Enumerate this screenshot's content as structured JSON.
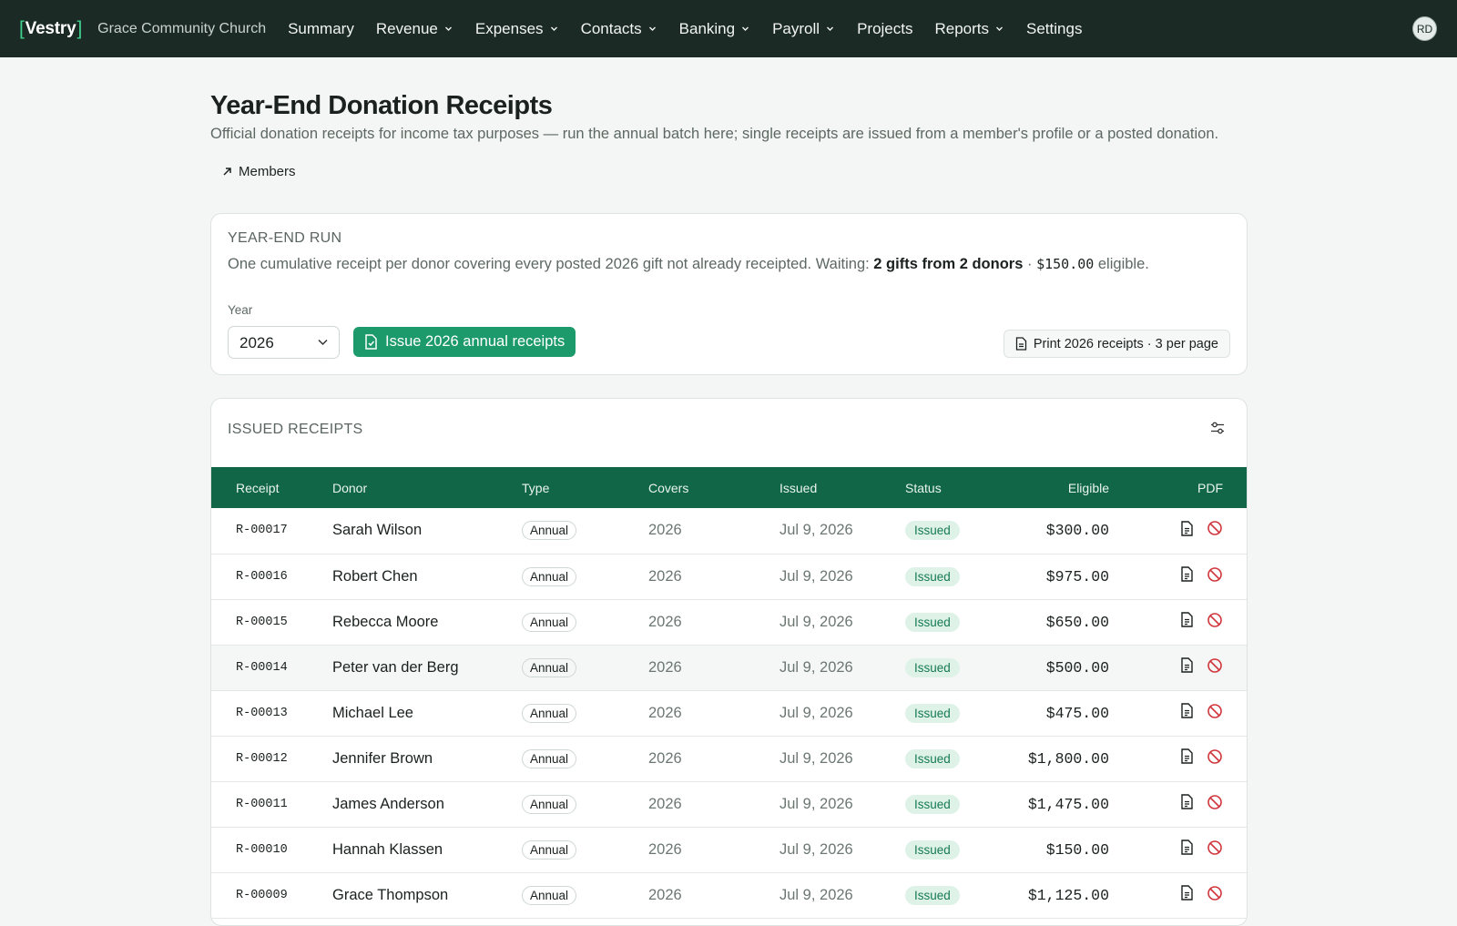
{
  "nav": {
    "logo": "Vestry",
    "org": "Grace Community Church",
    "items": [
      {
        "label": "Summary",
        "dropdown": false
      },
      {
        "label": "Revenue",
        "dropdown": true
      },
      {
        "label": "Expenses",
        "dropdown": true
      },
      {
        "label": "Contacts",
        "dropdown": true
      },
      {
        "label": "Banking",
        "dropdown": true
      },
      {
        "label": "Payroll",
        "dropdown": true
      },
      {
        "label": "Projects",
        "dropdown": false
      },
      {
        "label": "Reports",
        "dropdown": true
      },
      {
        "label": "Settings",
        "dropdown": false
      }
    ],
    "avatar": "RD"
  },
  "page": {
    "title": "Year-End Donation Receipts",
    "subtitle": "Official donation receipts for income tax purposes — run the annual batch here; single receipts are issued from a member's profile or a posted donation.",
    "members_link": "Members"
  },
  "run": {
    "label": "YEAR-END RUN",
    "desc_prefix": "One cumulative receipt per donor covering every posted 2026 gift not already receipted. Waiting: ",
    "desc_waiting": "2 gifts from 2 donors",
    "desc_sep": " · ",
    "desc_amount": "$150.00",
    "desc_suffix": " eligible.",
    "year_label": "Year",
    "year_value": "2026",
    "issue_button": "Issue 2026 annual receipts",
    "print_button": "Print 2026 receipts · 3 per page"
  },
  "receipts": {
    "label": "ISSUED RECEIPTS",
    "columns": {
      "receipt": "Receipt",
      "donor": "Donor",
      "type": "Type",
      "covers": "Covers",
      "issued": "Issued",
      "status": "Status",
      "eligible": "Eligible",
      "pdf": "PDF"
    },
    "rows": [
      {
        "receipt": "R-00017",
        "donor": "Sarah Wilson",
        "type": "Annual",
        "covers": "2026",
        "issued": "Jul 9, 2026",
        "status": "Issued",
        "eligible": "$300.00"
      },
      {
        "receipt": "R-00016",
        "donor": "Robert Chen",
        "type": "Annual",
        "covers": "2026",
        "issued": "Jul 9, 2026",
        "status": "Issued",
        "eligible": "$975.00"
      },
      {
        "receipt": "R-00015",
        "donor": "Rebecca Moore",
        "type": "Annual",
        "covers": "2026",
        "issued": "Jul 9, 2026",
        "status": "Issued",
        "eligible": "$650.00"
      },
      {
        "receipt": "R-00014",
        "donor": "Peter van der Berg",
        "type": "Annual",
        "covers": "2026",
        "issued": "Jul 9, 2026",
        "status": "Issued",
        "eligible": "$500.00"
      },
      {
        "receipt": "R-00013",
        "donor": "Michael Lee",
        "type": "Annual",
        "covers": "2026",
        "issued": "Jul 9, 2026",
        "status": "Issued",
        "eligible": "$475.00"
      },
      {
        "receipt": "R-00012",
        "donor": "Jennifer Brown",
        "type": "Annual",
        "covers": "2026",
        "issued": "Jul 9, 2026",
        "status": "Issued",
        "eligible": "$1,800.00"
      },
      {
        "receipt": "R-00011",
        "donor": "James Anderson",
        "type": "Annual",
        "covers": "2026",
        "issued": "Jul 9, 2026",
        "status": "Issued",
        "eligible": "$1,475.00"
      },
      {
        "receipt": "R-00010",
        "donor": "Hannah Klassen",
        "type": "Annual",
        "covers": "2026",
        "issued": "Jul 9, 2026",
        "status": "Issued",
        "eligible": "$150.00"
      },
      {
        "receipt": "R-00009",
        "donor": "Grace Thompson",
        "type": "Annual",
        "covers": "2026",
        "issued": "Jul 9, 2026",
        "status": "Issued",
        "eligible": "$1,125.00"
      }
    ]
  },
  "colors": {
    "nav_bg": "#1b2a24",
    "accent": "#1d9a6c",
    "table_header": "#106647",
    "status_bg": "#dff2e8",
    "void": "#d0353b"
  }
}
